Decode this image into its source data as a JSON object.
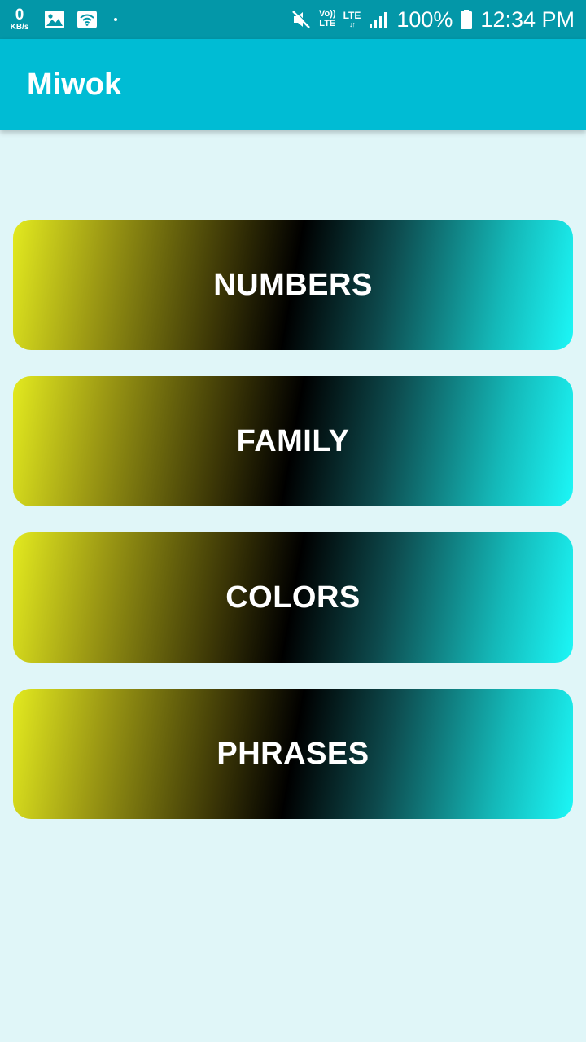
{
  "status_bar": {
    "data_rate_value": "0",
    "data_rate_unit": "KB/s",
    "volte_top": "Vo))",
    "volte_bottom": "LTE",
    "lte_label": "LTE",
    "lte_arrows": "↓↑",
    "battery_percent": "100%",
    "time": "12:34 PM",
    "icons": [
      "gallery-icon",
      "wifi-icon",
      "notification-dot-icon",
      "mute-icon",
      "volte-icon",
      "lte-icon",
      "signal-icon",
      "battery-icon"
    ]
  },
  "app_bar": {
    "title": "Miwok"
  },
  "categories": [
    {
      "label": "NUMBERS"
    },
    {
      "label": "FAMILY"
    },
    {
      "label": "COLORS"
    },
    {
      "label": "PHRASES"
    }
  ],
  "colors": {
    "status_bar": "#0397a8",
    "app_bar": "#00bcd4",
    "background": "#e0f6f8",
    "gradient_start": "#e3ea1f",
    "gradient_mid": "#000000",
    "gradient_end": "#1cf7f7",
    "label_text": "#ffffff"
  }
}
